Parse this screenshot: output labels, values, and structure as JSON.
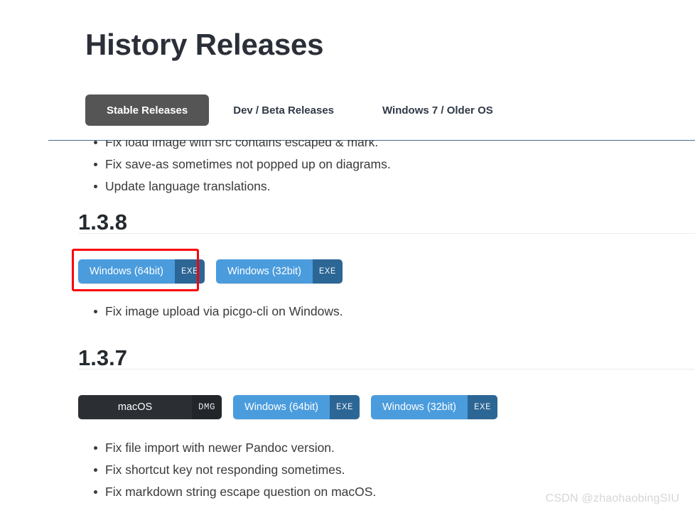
{
  "page": {
    "title": "History Releases",
    "watermark": "CSDN @zhaohaobingSIU"
  },
  "tabs": [
    {
      "label": "Stable Releases",
      "active": true
    },
    {
      "label": "Dev / Beta Releases",
      "active": false
    },
    {
      "label": "Windows 7 / Older OS",
      "active": false
    }
  ],
  "top_notes": [
    "Fix load image with src contains escaped & mark.",
    "Fix save-as sometimes not popped up on diagrams.",
    "Update language translations."
  ],
  "releases": [
    {
      "version": "1.3.8",
      "downloads": [
        {
          "label": "Windows (64bit)",
          "ext": "EXE",
          "kind": "win",
          "highlighted": true
        },
        {
          "label": "Windows (32bit)",
          "ext": "EXE",
          "kind": "win",
          "highlighted": false
        }
      ],
      "notes": [
        "Fix image upload via picgo-cli on Windows."
      ]
    },
    {
      "version": "1.3.7",
      "downloads": [
        {
          "label": "macOS",
          "ext": "DMG",
          "kind": "mac",
          "highlighted": false
        },
        {
          "label": "Windows (64bit)",
          "ext": "EXE",
          "kind": "win",
          "highlighted": false
        },
        {
          "label": "Windows (32bit)",
          "ext": "EXE",
          "kind": "win",
          "highlighted": false
        }
      ],
      "notes": [
        "Fix file import with newer Pandoc version.",
        "Fix shortcut key not responding sometimes.",
        "Fix markdown string escape question on macOS."
      ]
    }
  ],
  "colors": {
    "active_tab_bg": "#555555",
    "windows_btn": "#4a9cdd",
    "windows_ext": "#2c6695",
    "mac_btn": "#2b2f33",
    "mac_ext": "#22262a",
    "highlight_box": "#fb0007",
    "heading": "#24292e",
    "body_text": "#3a3a3a"
  }
}
